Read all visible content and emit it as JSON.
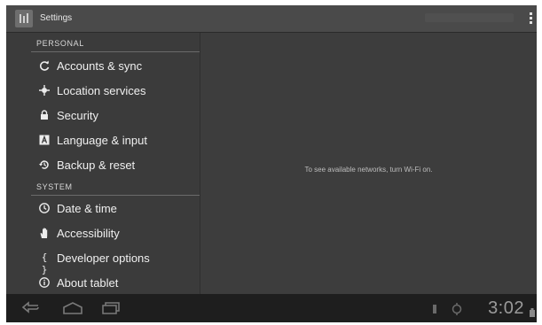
{
  "app": {
    "title": "Settings"
  },
  "sections": {
    "personal": "PERSONAL",
    "system": "SYSTEM"
  },
  "personal_items": [
    {
      "label": "Accounts & sync",
      "icon": "sync-icon"
    },
    {
      "label": "Location services",
      "icon": "location-icon"
    },
    {
      "label": "Security",
      "icon": "lock-icon"
    },
    {
      "label": "Language & input",
      "icon": "keyboard-icon"
    },
    {
      "label": "Backup & reset",
      "icon": "backup-icon"
    }
  ],
  "system_items": [
    {
      "label": "Date & time",
      "icon": "clock-icon"
    },
    {
      "label": "Accessibility",
      "icon": "hand-icon"
    },
    {
      "label": "Developer options",
      "icon": "braces-icon"
    },
    {
      "label": "About tablet",
      "icon": "info-icon"
    }
  ],
  "content": {
    "message": "To see available networks, turn Wi-Fi on."
  },
  "status": {
    "time": "3:02"
  }
}
